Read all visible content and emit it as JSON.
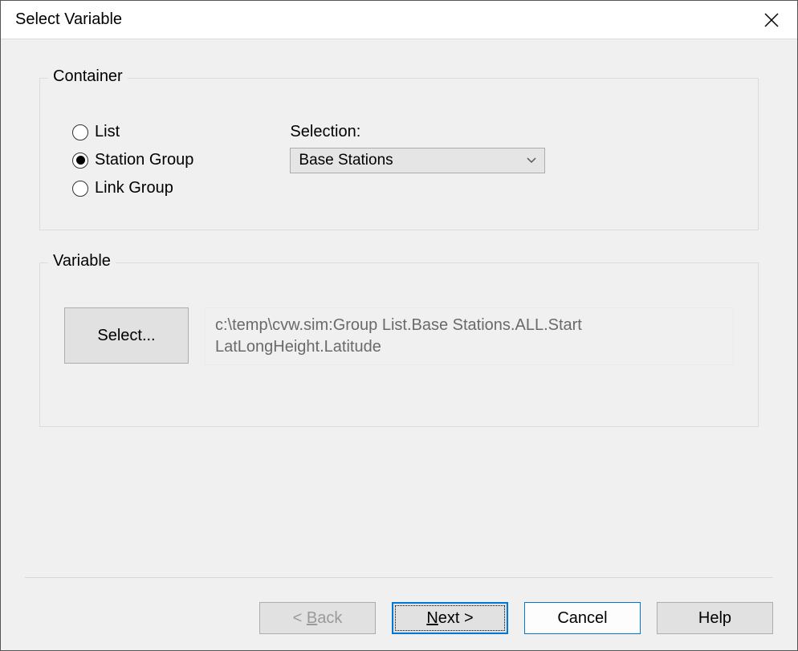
{
  "dialog": {
    "title": "Select Variable"
  },
  "container": {
    "legend": "Container",
    "radios": {
      "list": "List",
      "station_group": "Station Group",
      "link_group": "Link Group"
    },
    "selection_label": "Selection:",
    "selection_value": "Base Stations"
  },
  "variable": {
    "legend": "Variable",
    "select_btn": "Select...",
    "path": "c:\\temp\\cvw.sim:Group List.Base Stations.ALL.Start LatLongHeight.Latitude"
  },
  "buttons": {
    "back_prefix": "< ",
    "back_mnemonic": "B",
    "back_suffix": "ack",
    "next_mnemonic": "N",
    "next_suffix": "ext >",
    "cancel": "Cancel",
    "help": "Help"
  }
}
